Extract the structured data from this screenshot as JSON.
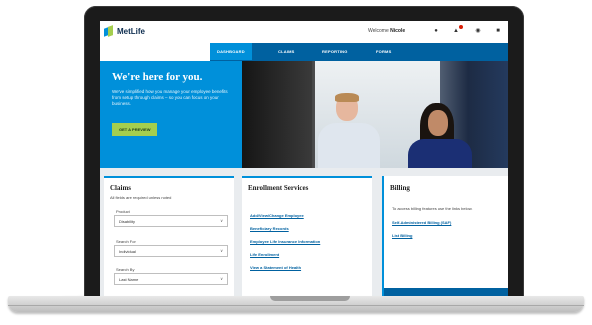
{
  "app": {
    "logo_text": "MetLife"
  },
  "header": {
    "welcome_prefix": "Welcome",
    "user_name": "Nicole",
    "icons": [
      "user-icon",
      "alert-icon",
      "chat-icon",
      "lock-icon"
    ]
  },
  "nav": {
    "items": [
      {
        "label": "DASHBOARD",
        "active": true
      },
      {
        "label": "CLAIMS"
      },
      {
        "label": "REPORTING"
      },
      {
        "label": "FORMS"
      }
    ]
  },
  "hero": {
    "title": "We're here for you.",
    "subtitle": "We've simplified how you manage your employee benefits from setup through claims – so you can focus on your business.",
    "button_label": "GET A PREVIEW"
  },
  "claims": {
    "title": "Claims",
    "note": "All fields are required unless noted",
    "fields": [
      {
        "label": "Product",
        "value": "Disability"
      },
      {
        "label": "Search For",
        "value": "Individual"
      },
      {
        "label": "Search By",
        "value": "Last Name"
      }
    ]
  },
  "enrollment": {
    "title": "Enrollment Services",
    "links": [
      "Add/View/Change Employee",
      "Beneficiary Records",
      "Employee Life Insurance Information",
      "Life Enrollment",
      "View a Statement of Health"
    ]
  },
  "billing": {
    "title": "Billing",
    "note": "To access billing features use the links below.",
    "links": [
      "Self-Administered Billing (SAF)",
      "List Billing"
    ]
  },
  "colors": {
    "brand_blue": "#0090da",
    "nav_blue": "#0061a0",
    "accent_green": "#a4ce4e"
  }
}
